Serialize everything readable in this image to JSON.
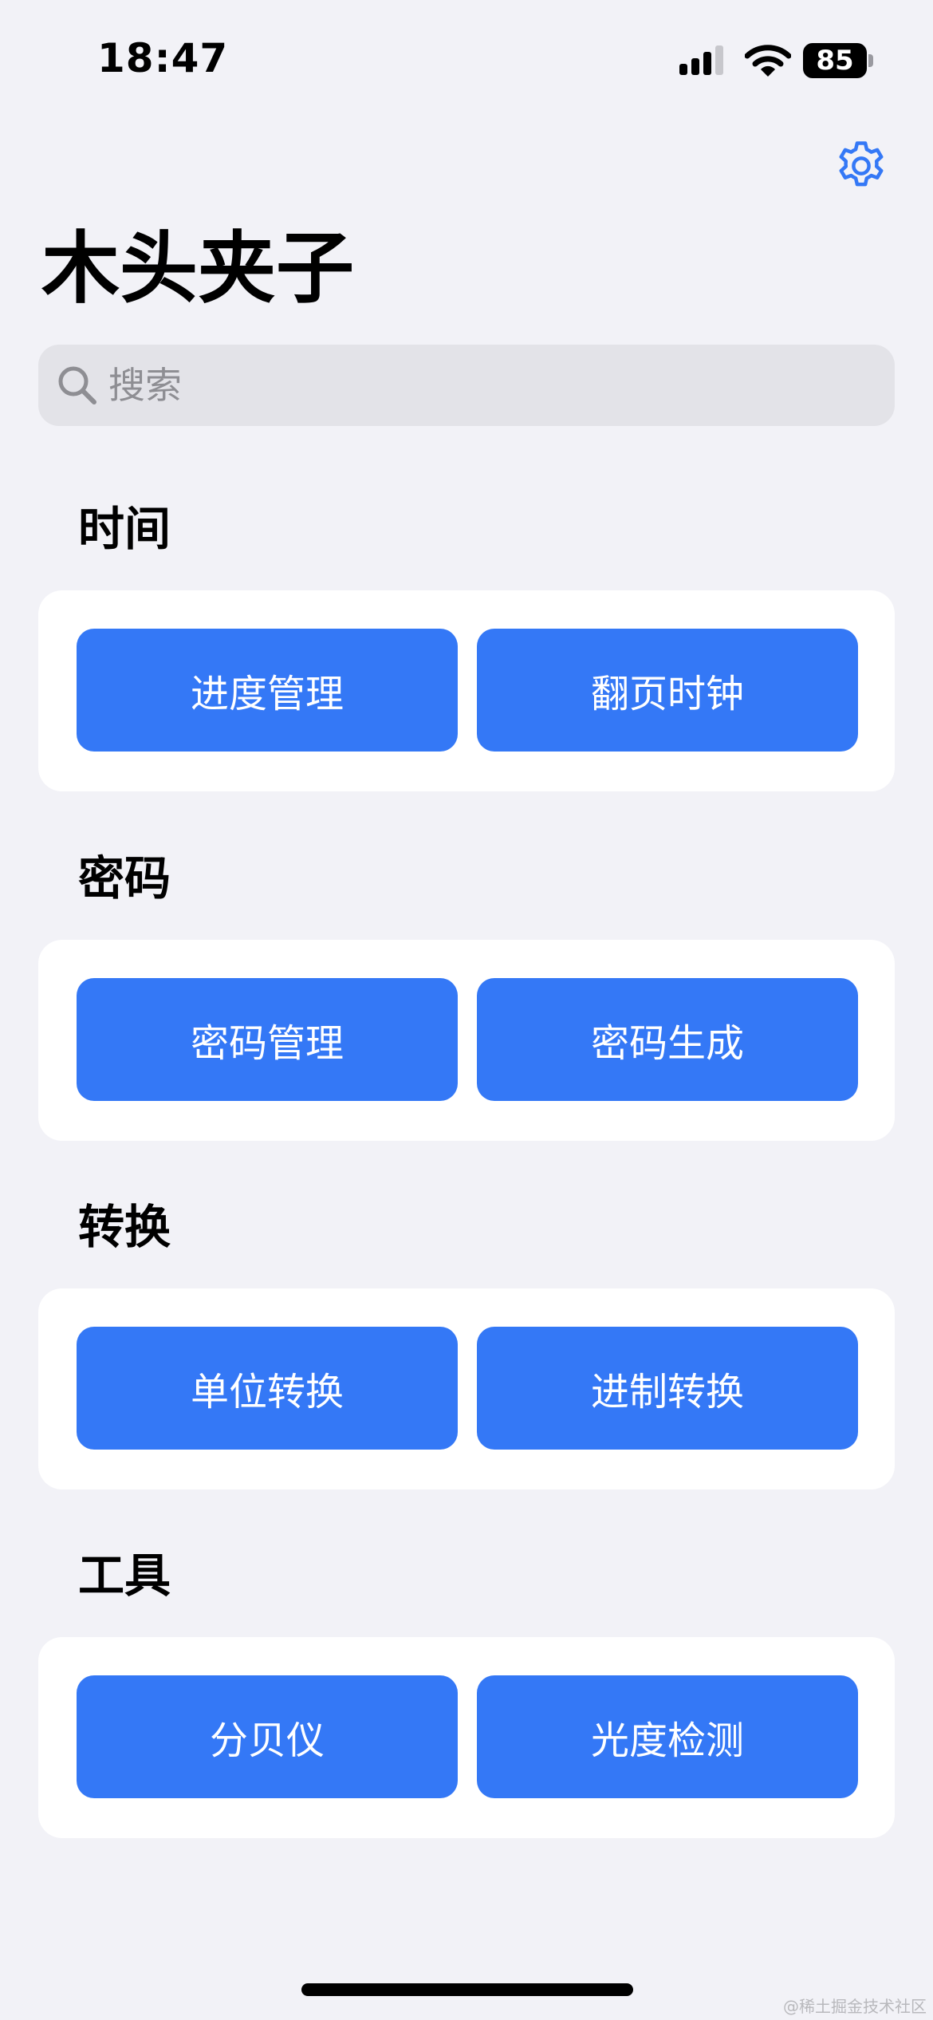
{
  "status_bar": {
    "time": "18:47",
    "battery_level": "85"
  },
  "header": {
    "title": "木头夹子",
    "settings_icon": "gear-icon"
  },
  "search": {
    "placeholder": "搜索",
    "icon": "search-icon"
  },
  "sections": [
    {
      "title": "时间",
      "buttons": [
        "进度管理",
        "翻页时钟"
      ]
    },
    {
      "title": "密码",
      "buttons": [
        "密码管理",
        "密码生成"
      ]
    },
    {
      "title": "转换",
      "buttons": [
        "单位转换",
        "进制转换"
      ]
    },
    {
      "title": "工具",
      "buttons": [
        "分贝仪",
        "光度检测"
      ]
    }
  ],
  "watermark": "@稀土掘金技术社区",
  "colors": {
    "accent": "#3478f6",
    "background": "#f2f2f7",
    "card": "#ffffff",
    "search_bg": "#e3e3e8"
  }
}
